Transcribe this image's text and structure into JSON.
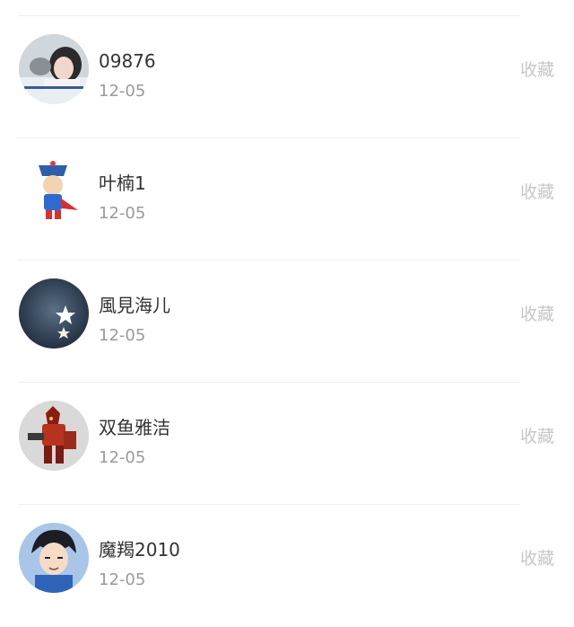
{
  "list": {
    "items": [
      {
        "name": "09876",
        "date": "12-05",
        "action_label": "收藏",
        "avatar_icon": "photo-avatar-icon"
      },
      {
        "name": "叶楠1",
        "date": "12-05",
        "action_label": "收藏",
        "avatar_icon": "cartoon-hero-avatar-icon"
      },
      {
        "name": "風見海儿",
        "date": "12-05",
        "action_label": "收藏",
        "avatar_icon": "star-avatar-icon"
      },
      {
        "name": "双鱼雅洁",
        "date": "12-05",
        "action_label": "收藏",
        "avatar_icon": "robot-avatar-icon"
      },
      {
        "name": "魔羯2010",
        "date": "12-05",
        "action_label": "收藏",
        "avatar_icon": "anime-boy-avatar-icon"
      }
    ]
  },
  "colors": {
    "name_text": "#333333",
    "date_text": "#9a9a9a",
    "action_text": "#c7c7c7",
    "divider": "#eeeeee"
  }
}
